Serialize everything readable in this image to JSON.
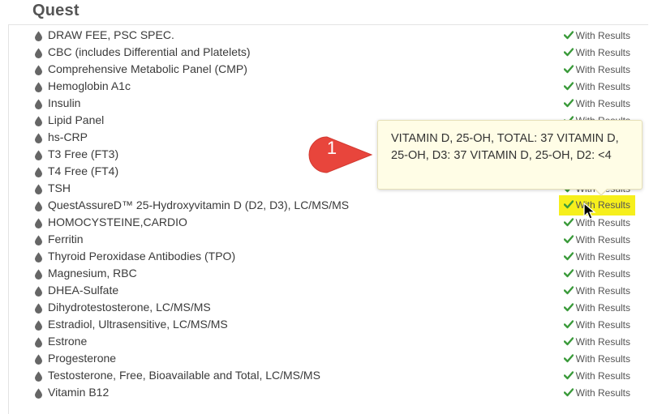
{
  "section": {
    "title": "Quest"
  },
  "status_label": "With Results",
  "colors": {
    "check": "#3a9a3a",
    "drop": "#666666",
    "highlight": "#f6ef1c",
    "marker": "#e8453c"
  },
  "tests": [
    {
      "name": "DRAW FEE, PSC SPEC."
    },
    {
      "name": "CBC (includes Differential and Platelets)"
    },
    {
      "name": "Comprehensive Metabolic Panel (CMP)"
    },
    {
      "name": "Hemoglobin A1c"
    },
    {
      "name": "Insulin"
    },
    {
      "name": "Lipid Panel"
    },
    {
      "name": "hs-CRP"
    },
    {
      "name": "T3 Free (FT3)"
    },
    {
      "name": "T4 Free (FT4)"
    },
    {
      "name": "TSH"
    },
    {
      "name": "QuestAssureD™ 25-Hydroxyvitamin D (D2, D3), LC/MS/MS"
    },
    {
      "name": "HOMOCYSTEINE,CARDIO"
    },
    {
      "name": "Ferritin"
    },
    {
      "name": "Thyroid Peroxidase Antibodies (TPO)"
    },
    {
      "name": "Magnesium, RBC"
    },
    {
      "name": "DHEA-Sulfate"
    },
    {
      "name": "Dihydrotestosterone, LC/MS/MS"
    },
    {
      "name": "Estradiol, Ultrasensitive, LC/MS/MS"
    },
    {
      "name": "Estrone"
    },
    {
      "name": "Progesterone"
    },
    {
      "name": "Testosterone, Free, Bioavailable and Total, LC/MS/MS"
    },
    {
      "name": "Vitamin B12"
    }
  ],
  "tooltip": {
    "text": "VITAMIN D, 25-OH, TOTAL: 37 VITAMIN D, 25-OH, D3: 37 VITAMIN D, 25-OH, D2: <4"
  },
  "callout": {
    "number": "1"
  }
}
